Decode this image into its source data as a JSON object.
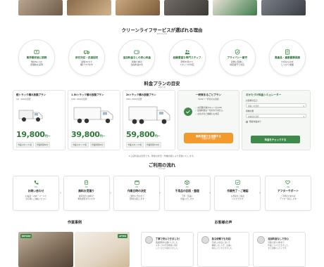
{
  "reasons_section": {
    "title": "クリーンライフサービスが選ばれる理由",
    "subtitle": "REASON",
    "items": [
      {
        "title": "業界最安値に挑戦",
        "desc": "他社No.1の\n低価格を実現",
        "icon": "yen-tag-icon"
      },
      {
        "title": "即日対応・迅速回収",
        "desc": "最短30分で\n駆けつけます",
        "icon": "truck-icon"
      },
      {
        "title": "追加料金なしの安心料金",
        "desc": "見積り後の\n追加料金0円",
        "icon": "wallet-icon"
      },
      {
        "title": "経験豊富な専門スタッフ",
        "desc": "研修を受けた\nスタッフが対応",
        "icon": "staff-icon"
      },
      {
        "title": "プライバシー厳守",
        "desc": "近隣に配慮し\n秘密厳守で対応",
        "icon": "shield-icon"
      },
      {
        "title": "貴重品・重要書類保護",
        "desc": "大切なものを\nしっかり保護",
        "icon": "document-icon"
      }
    ]
  },
  "plans_section": {
    "title": "料金プランの目安",
    "subtitle": "PRICE",
    "plans": [
      {
        "name": "軽トラック積み放題プラン",
        "spec": "1R・1DKの目安",
        "price": "19,800",
        "unit": "円〜",
        "tags": [
          "作業スタッフ1名",
          "作業時間60分"
        ]
      },
      {
        "name": "1.5tトラック積み放題プラン",
        "spec": "1DK〜2DKの目安",
        "price": "39,800",
        "unit": "円〜",
        "tags": [
          "作業スタッフ2名",
          "作業時間90分"
        ]
      },
      {
        "name": "2tトラック積み放題プラン",
        "spec": "2DK〜3DKの目安",
        "price": "59,800",
        "unit": "円〜",
        "tags": [
          "作業スタッフ3名",
          "作業時間120分"
        ]
      }
    ],
    "recommend": {
      "name": "一軒家まるごとプラン",
      "spec": "3LDK〜一軒家のお客様",
      "bullets": [
        "お見積り後のキャンセルOK",
        "追加料金は一切かかりません",
        "お急ぎのご依頼にも対応"
      ],
      "cta": "無料見積りを依頼する",
      "cta_sub": "お電話1本で完結"
    },
    "simulator": {
      "title": "おかたづけ料金シミュレーター",
      "field1_label": "お部屋の広さ",
      "field1_value": "間取りを選択",
      "field2_label": "荷物の量",
      "field2_value": "荷物量を選択",
      "checkbox_label": "階段作業あり",
      "button": "料金をチェックする"
    },
    "note": "※上記料金は目安です。現地の状況・作業内容により変動いたします。"
  },
  "flow_section": {
    "title": "ご利用の流れ",
    "subtitle": "FLOW",
    "steps": [
      {
        "num": "01",
        "title": "お問い合わせ",
        "desc": "お電話・LINE・メールで\nお気軽にご連絡ください",
        "icon": "phone-icon"
      },
      {
        "num": "02",
        "title": "無料お見積り",
        "desc": "最短当日に無料で\n現地調査を行います",
        "icon": "clipboard-icon"
      },
      {
        "num": "03",
        "title": "作業日時の決定",
        "desc": "ご都合に合わせて\n日時を決定します",
        "icon": "calendar-icon"
      },
      {
        "num": "04",
        "title": "不用品の回収・整理",
        "desc": "丁寧・迅速に\n作業いたします",
        "icon": "box-icon"
      },
      {
        "num": "05",
        "title": "作業完了・ご確認",
        "desc": "お部屋をご確認\nいただきます",
        "icon": "check-icon"
      },
      {
        "num": "06",
        "title": "アフターサポート",
        "desc": "ご不明点があれば\nアフター対応します",
        "icon": "heart-icon"
      }
    ]
  },
  "cases_section": {
    "title": "作業事例",
    "before_label": "BEFORE",
    "after_label": "AFTER"
  },
  "reviews_section": {
    "title": "お客様の声",
    "reviews": [
      {
        "heading": "丁寧で安心できました！",
        "body": "遺品整理をお願いしました。\nスタッフの方が親身に対応\nしてくださり助かりました。"
      },
      {
        "heading": "急な依頼でも対応！",
        "body": "引越しの前日に急いで\n依頼しましたが、迅速に\n対応していただけました。"
      },
      {
        "heading": "追加料金なしで安心",
        "body": "見積り通りの料金で\n作業していただきました。\nまたお願いしたいです。"
      }
    ]
  },
  "colors": {
    "accent": "#3f8a4a",
    "price": "#2f7a3b",
    "cta": "#f29a2e"
  }
}
